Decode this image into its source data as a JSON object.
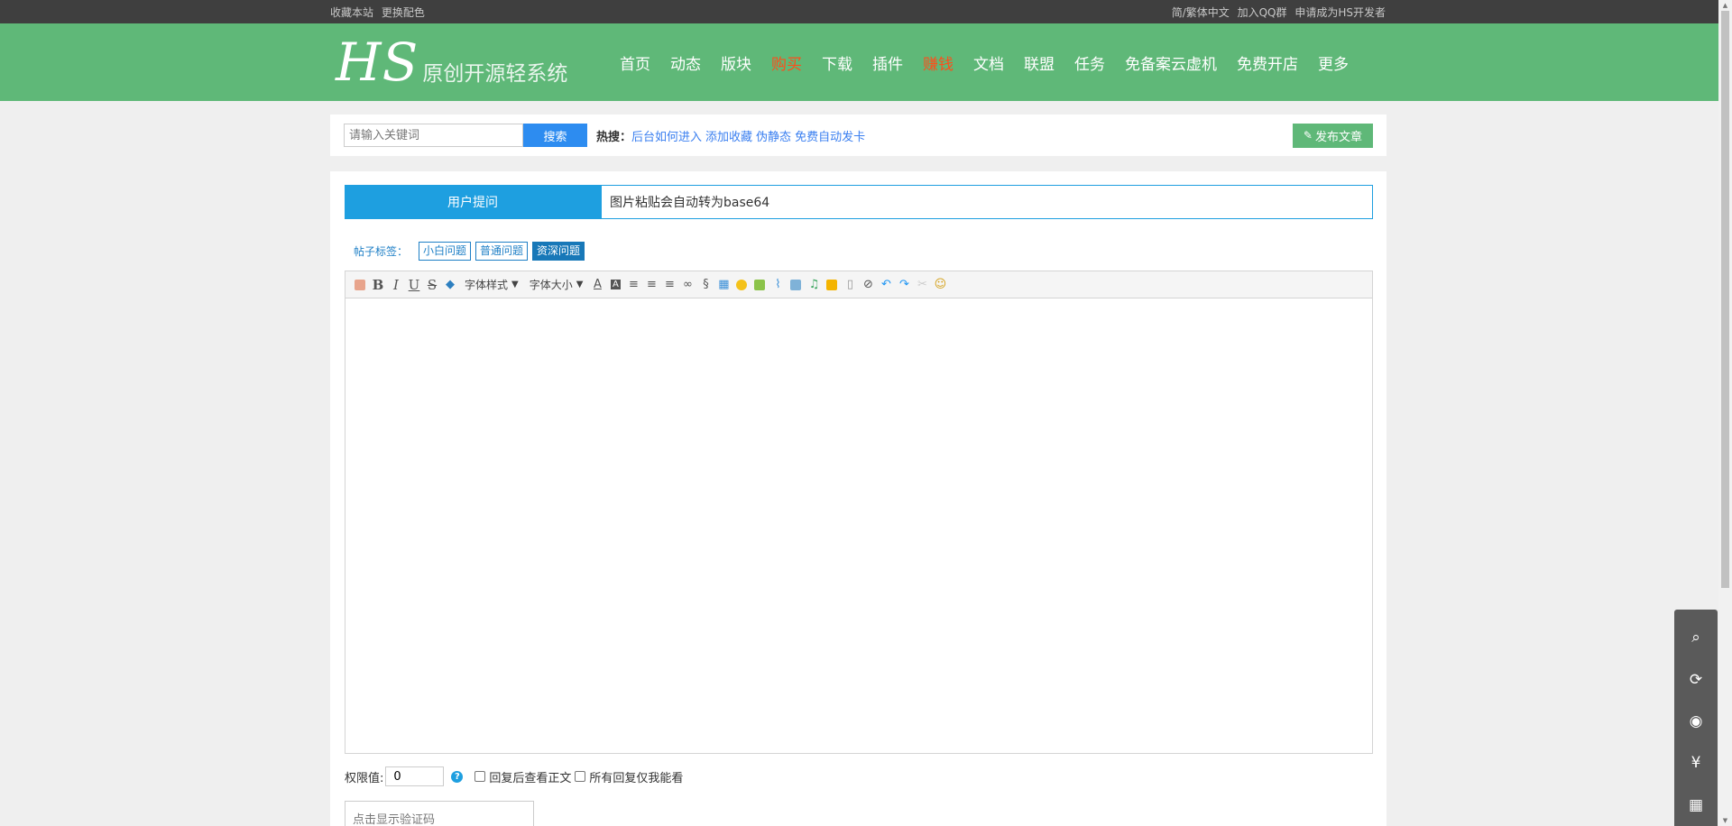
{
  "topbar": {
    "left": [
      "收藏本站",
      "更换配色"
    ],
    "right": [
      "简/繁体中文",
      "加入QQ群",
      "申请成为HS开发者"
    ]
  },
  "logo": {
    "mark": "HS",
    "subtitle": "原创开源轻系统"
  },
  "nav": [
    {
      "label": "首页",
      "hot": false
    },
    {
      "label": "动态",
      "hot": false
    },
    {
      "label": "版块",
      "hot": false
    },
    {
      "label": "购买",
      "hot": true
    },
    {
      "label": "下载",
      "hot": false
    },
    {
      "label": "插件",
      "hot": false
    },
    {
      "label": "赚钱",
      "hot": true
    },
    {
      "label": "文档",
      "hot": false
    },
    {
      "label": "联盟",
      "hot": false
    },
    {
      "label": "任务",
      "hot": false
    },
    {
      "label": "免备案云虚机",
      "hot": false
    },
    {
      "label": "免费开店",
      "hot": false
    },
    {
      "label": "更多",
      "hot": false
    }
  ],
  "search": {
    "placeholder": "请输入关键词",
    "button": "搜索",
    "hot_label": "热搜：",
    "hot_links": [
      "后台如何进入",
      "添加收藏",
      "伪静态",
      "免费自动发卡"
    ],
    "publish": "发布文章"
  },
  "post": {
    "category": "用户提问",
    "title_value": "图片粘贴会自动转为base64",
    "tags_label": "帖子标签：",
    "tags": [
      {
        "label": "小白问题",
        "active": false
      },
      {
        "label": "普通问题",
        "active": false
      },
      {
        "label": "资深问题",
        "active": true
      }
    ]
  },
  "editor": {
    "font_style": "字体样式",
    "font_size": "字体大小"
  },
  "permission": {
    "label": "权限值:",
    "value": "0",
    "help": "?",
    "option1": "回复后查看正文",
    "option2": "所有回复仅我能看"
  },
  "captcha": {
    "text": "点击显示验证码"
  },
  "colors": {
    "header": "#5fb878",
    "accent": "#1e9fe0",
    "hot": "#ff4d1a"
  }
}
